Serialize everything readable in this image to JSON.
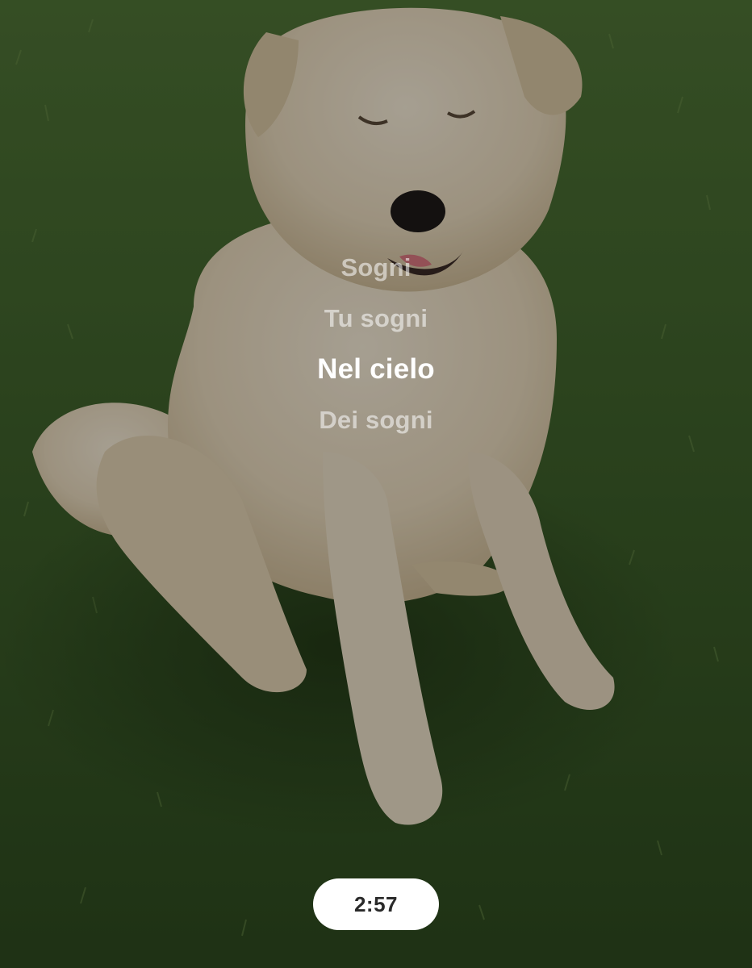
{
  "photo": {
    "subject": "white-dog-on-grass"
  },
  "lyrics": {
    "lines": [
      "Sogni",
      "Tu sogni",
      "Nel cielo",
      "Dei sogni"
    ],
    "active_index": 2
  },
  "timer": {
    "label": "2:57"
  },
  "colors": {
    "grass": "#3b5a2a",
    "dog_fur": "#e8dcc4",
    "active_lyric": "#ffffff",
    "inactive_lyric": "#bfbfbf",
    "timer_bg": "#ffffff",
    "timer_text": "#2a2a2a"
  }
}
